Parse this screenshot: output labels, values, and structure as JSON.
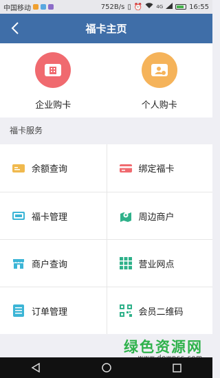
{
  "status_bar": {
    "carrier": "中国移动",
    "speed": "752B/s",
    "network": "4G",
    "battery_percent": 85,
    "time": "16:55"
  },
  "header": {
    "title": "福卡主页",
    "back_icon": "back-icon"
  },
  "purchase": [
    {
      "label": "企业购卡",
      "icon": "enterprise-card-icon",
      "color": "#f06a6f"
    },
    {
      "label": "个人购卡",
      "icon": "personal-card-icon",
      "color": "#f5b35a"
    }
  ],
  "services": {
    "title": "福卡服务",
    "rows": [
      [
        {
          "label": "余额查询",
          "icon": "balance-icon",
          "color": "#f0b94e"
        },
        {
          "label": "绑定福卡",
          "icon": "bind-card-icon",
          "color": "#f06a6f"
        }
      ],
      [
        {
          "label": "福卡管理",
          "icon": "card-manage-icon",
          "color": "#3cb5d6"
        },
        {
          "label": "周边商户",
          "icon": "nearby-merchant-icon",
          "color": "#2fb18a"
        }
      ],
      [
        {
          "label": "商户查询",
          "icon": "shop-search-icon",
          "color": "#3cb5d6"
        },
        {
          "label": "营业网点",
          "icon": "branch-grid-icon",
          "color": "#2fb18a"
        }
      ],
      [
        {
          "label": "订单管理",
          "icon": "order-icon",
          "color": "#3cb5d6"
        },
        {
          "label": "会员二维码",
          "icon": "qrcode-icon",
          "color": "#2fb18a"
        }
      ]
    ]
  },
  "watermark": {
    "main": "绿色资源网",
    "sub": "www.downcc.com"
  },
  "nav_bar": {
    "buttons": [
      "back-nav-icon",
      "home-nav-icon",
      "recent-nav-icon"
    ]
  }
}
